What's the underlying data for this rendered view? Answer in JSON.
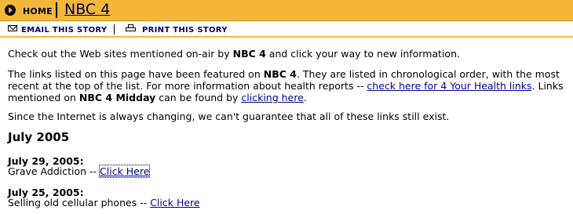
{
  "header": {
    "home_label": "HOME",
    "title": "NBC 4",
    "accent_color": "#f5b73a"
  },
  "tools": {
    "email_icon": "envelope-icon",
    "email_label": "EMAIL THIS STORY",
    "print_icon": "printer-icon",
    "print_label": "PRINT THIS STORY"
  },
  "intro": {
    "p1_before": "Check out the Web sites mentioned on-air by ",
    "p1_bold": "NBC 4",
    "p1_after": " and click your way to new information.",
    "p2_a": "The links listed on this page have been featured on ",
    "p2_bold1": "NBC 4",
    "p2_b": ". They are listed in chronological order, with the most recent at the top of the list. For more information about health reports -- ",
    "p2_link1": "check here for 4 Your Health links",
    "p2_c": ". Links mentioned on ",
    "p2_bold2": "NBC 4 Midday",
    "p2_d": " can be found by ",
    "p2_link2": "clicking here",
    "p2_e": ".",
    "p3": "Since the Internet is always changing, we can't guarantee that all of these links still exist."
  },
  "month_heading": "July 2005",
  "entries": [
    {
      "date": "July 29, 2005:",
      "text": "Grave Addiction -- ",
      "link": "Click Here"
    },
    {
      "date": "July 25, 2005:",
      "text": "Selling old cellular phones -- ",
      "link": "Click Here"
    }
  ]
}
